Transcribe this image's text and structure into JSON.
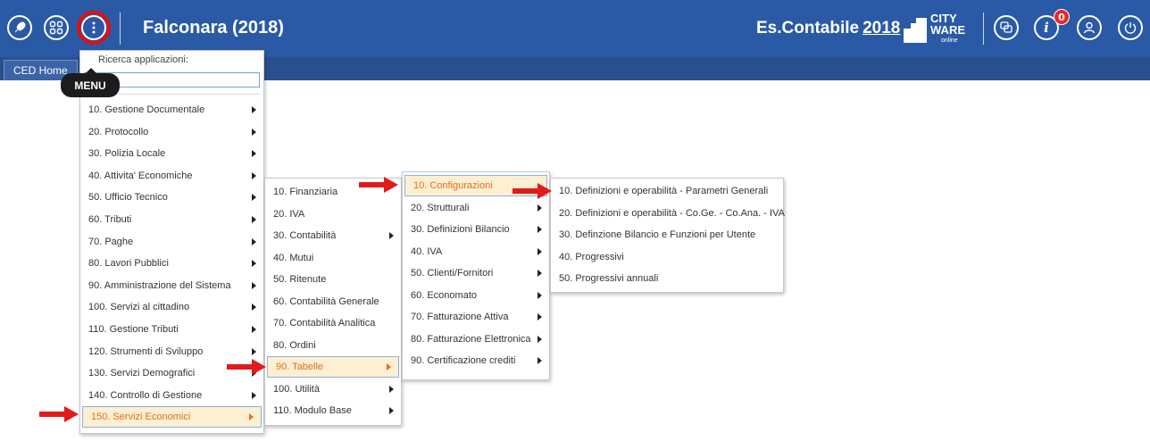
{
  "topbar": {
    "title": "Falconara (2018)",
    "esercizio_label": "Es.Contabile",
    "esercizio_year": "2018",
    "logo_line1": "CITY",
    "logo_line2": "WARE",
    "logo_sub": "online",
    "notifications_count": "0",
    "icons": [
      "rocket-icon",
      "apps-grid-icon",
      "more-vertical-icon",
      "window-switch-icon",
      "info-icon",
      "user-icon",
      "power-icon"
    ],
    "bar_color": "#2a5aa6",
    "highlight_color": "#e10f0f"
  },
  "subbar": {
    "tab_label": "CED Home"
  },
  "tooltip": {
    "label": "MENU"
  },
  "main_menu": {
    "search_label": "Ricerca applicazioni:",
    "search_value": "",
    "items": [
      {
        "label": "10. Gestione Documentale"
      },
      {
        "label": "20. Protocollo"
      },
      {
        "label": "30. Polizia Locale"
      },
      {
        "label": "40. Attivita' Economiche"
      },
      {
        "label": "50. Ufficio Tecnico"
      },
      {
        "label": "60. Tributi"
      },
      {
        "label": "70. Paghe"
      },
      {
        "label": "80. Lavori Pubblici"
      },
      {
        "label": "90. Amministrazione del Sistema"
      },
      {
        "label": "100. Servizi al cittadino"
      },
      {
        "label": "110. Gestione Tributi"
      },
      {
        "label": "120. Strumenti di Sviluppo"
      },
      {
        "label": "130. Servizi Demografici"
      },
      {
        "label": "140. Controllo di Gestione"
      },
      {
        "label": "150. Servizi Economici"
      }
    ]
  },
  "submenu_economici": {
    "items": [
      {
        "label": "10. Finanziaria"
      },
      {
        "label": "20. IVA"
      },
      {
        "label": "30. Contabilità"
      },
      {
        "label": "40. Mutui"
      },
      {
        "label": "50. Ritenute"
      },
      {
        "label": "60. Contabilità Generale"
      },
      {
        "label": "70. Contabilità Analitica"
      },
      {
        "label": "80. Ordini"
      },
      {
        "label": "90. Tabelle"
      },
      {
        "label": "100. Utilità"
      },
      {
        "label": "110. Modulo Base"
      }
    ]
  },
  "submenu_tabelle": {
    "items": [
      {
        "label": "10. Configurazioni"
      },
      {
        "label": "20. Strutturali"
      },
      {
        "label": "30. Definizioni Bilancio"
      },
      {
        "label": "40. IVA"
      },
      {
        "label": "50. Clienti/Fornitori"
      },
      {
        "label": "60. Economato"
      },
      {
        "label": "70. Fatturazione Attiva"
      },
      {
        "label": "80. Fatturazione Elettronica"
      },
      {
        "label": "90. Certificazione crediti"
      }
    ]
  },
  "submenu_configurazioni": {
    "items": [
      {
        "label": "10. Definizioni e operabilità - Parametri Generali"
      },
      {
        "label": "20. Definizioni e operabilità - Co.Ge. - Co.Ana. - IVA"
      },
      {
        "label": "30. Definzione Bilancio e Funzioni per Utente"
      },
      {
        "label": "40. Progressivi"
      },
      {
        "label": "50. Progressivi annuali"
      }
    ]
  },
  "colors": {
    "active_item_bg": "#fcefd2",
    "active_item_text": "#e0701c",
    "annotation_arrow": "#e11b1b"
  }
}
